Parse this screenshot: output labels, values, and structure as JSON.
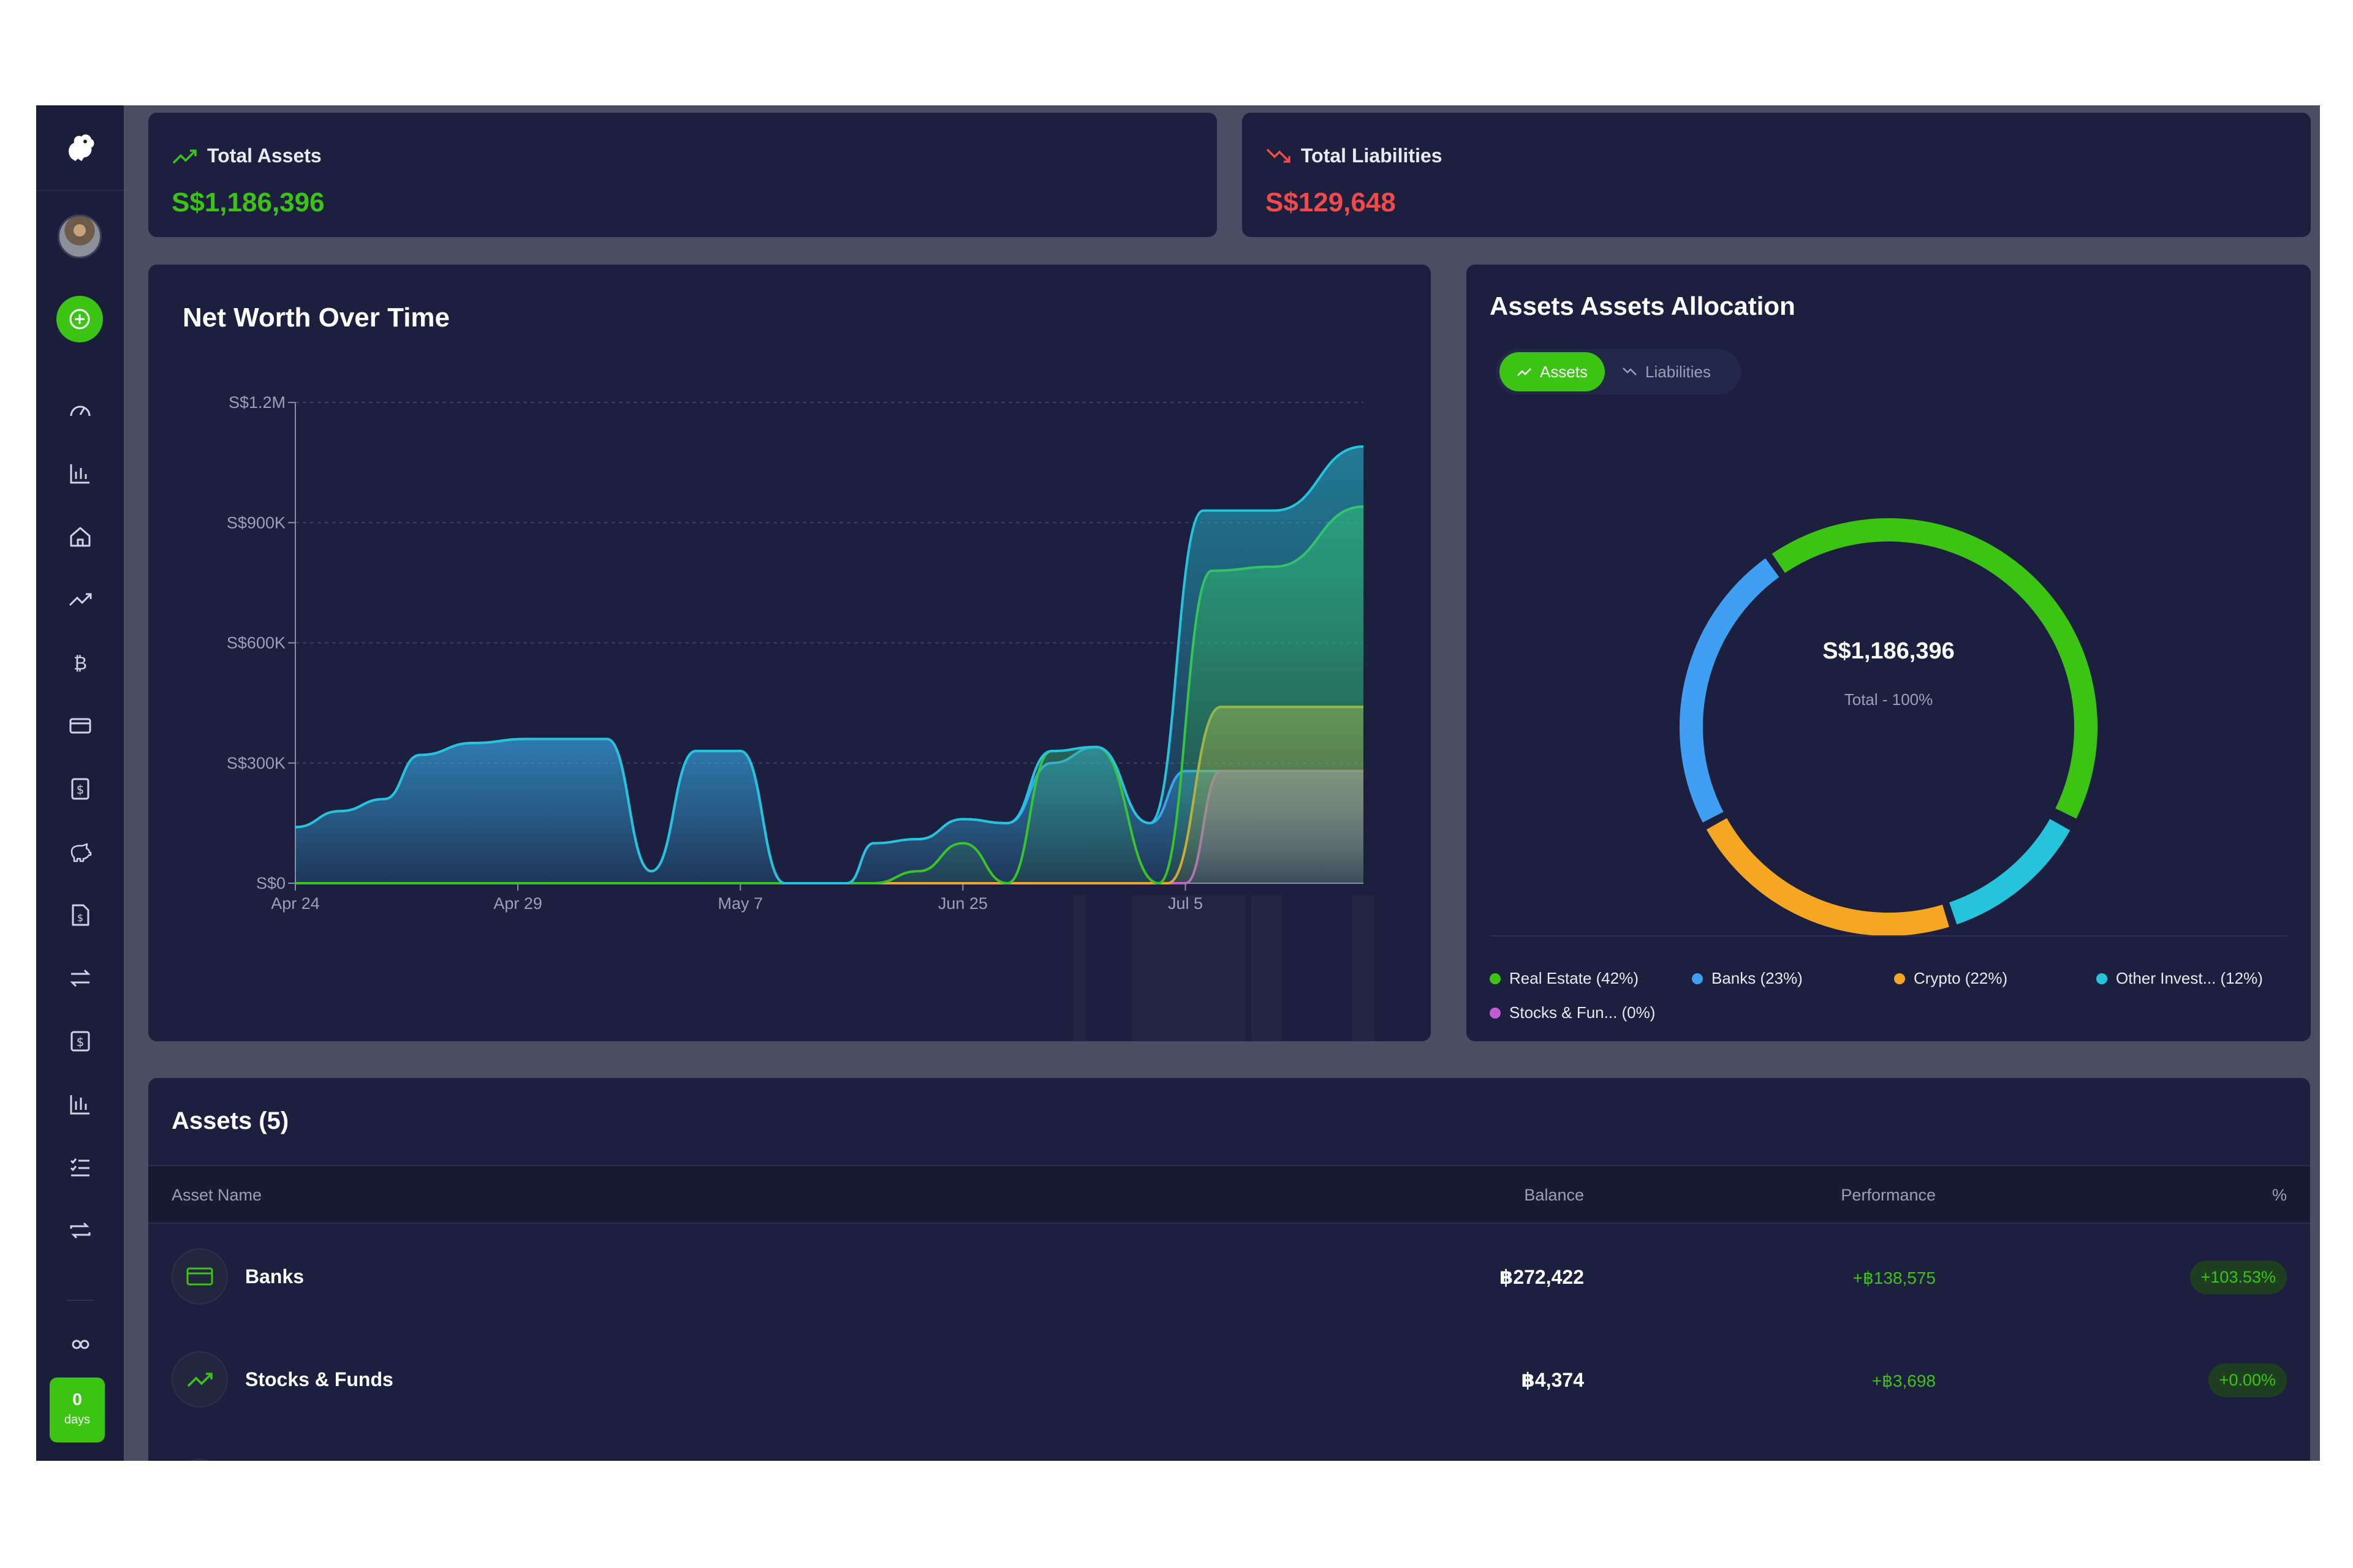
{
  "sidebar": {
    "nav": [
      "gauge-icon",
      "bar-chart-icon",
      "home-icon",
      "trending-up-icon",
      "bitcoin-icon",
      "credit-card-icon",
      "dollar-doc-icon",
      "piggy-bank-icon",
      "file-dollar-icon",
      "swap-arrows-icon",
      "dollar-box-icon",
      "bar-chart-2-icon",
      "list-check-icon",
      "repeat-icon"
    ],
    "streak_value": "0",
    "streak_label": "days"
  },
  "summary": {
    "assets_title": "Total Assets",
    "assets_value": "S$1,186,396",
    "liabilities_title": "Total Liabilities",
    "liabilities_value": "S$129,648"
  },
  "colors": {
    "green": "#3bc414",
    "red": "#f24a4a",
    "blue": "#3f9ff2",
    "orange": "#f5a623",
    "cyan": "#25c4dc",
    "purple": "#c25bd1",
    "card": "#1c1f3d"
  },
  "networth": {
    "title": "Net Worth Over Time",
    "chart_data": {
      "type": "area",
      "title": "Net Worth Over Time",
      "xlabel": "",
      "ylabel": "",
      "ylim": [
        0,
        1200000
      ],
      "yticks": [
        "S$0",
        "S$300K",
        "S$600K",
        "S$900K",
        "S$1.2M"
      ],
      "xticks": [
        "Apr 24",
        "Apr 29",
        "May 7",
        "Jun 25",
        "Jul 5"
      ],
      "series": [
        {
          "name": "Banks",
          "color": "#3f9ff2",
          "values": [
            [
              0,
              140000
            ],
            [
              1.0,
              180000
            ],
            [
              2.0,
              210000
            ],
            [
              2.8,
              320000
            ],
            [
              4.0,
              350000
            ],
            [
              5.2,
              360000
            ],
            [
              6.0,
              360000
            ],
            [
              7.0,
              360000
            ],
            [
              8.0,
              30000
            ],
            [
              9.0,
              330000
            ],
            [
              10.0,
              330000
            ],
            [
              11.0,
              0
            ],
            [
              12.4,
              0
            ],
            [
              13.0,
              100000
            ],
            [
              14.0,
              110000
            ],
            [
              15.0,
              160000
            ],
            [
              16.0,
              150000
            ],
            [
              17.0,
              300000
            ],
            [
              18.0,
              340000
            ],
            [
              19.2,
              150000
            ],
            [
              20.0,
              280000
            ],
            [
              24.0,
              280000
            ]
          ]
        },
        {
          "name": "Stocks & Fun...",
          "color": "#c25bd1",
          "values": [
            [
              0,
              0
            ],
            [
              13,
              0
            ],
            [
              16,
              0
            ],
            [
              20,
              0
            ],
            [
              20.8,
              280000
            ],
            [
              24,
              280000
            ]
          ]
        },
        {
          "name": "Crypto",
          "color": "#f5a623",
          "values": [
            [
              0,
              0
            ],
            [
              13,
              0
            ],
            [
              14,
              0
            ],
            [
              15,
              0
            ],
            [
              18,
              0
            ],
            [
              19.6,
              0
            ],
            [
              20.8,
              440000
            ],
            [
              24,
              440000
            ]
          ]
        },
        {
          "name": "Real Estate",
          "color": "#3bc414",
          "values": [
            [
              0,
              0
            ],
            [
              13,
              0
            ],
            [
              14,
              30000
            ],
            [
              15,
              100000
            ],
            [
              16,
              0
            ],
            [
              17,
              330000
            ],
            [
              18,
              340000
            ],
            [
              19.4,
              0
            ],
            [
              20.6,
              780000
            ],
            [
              22,
              790000
            ],
            [
              24,
              940000
            ]
          ]
        },
        {
          "name": "Other Invest...",
          "color": "#25c4dc",
          "values": [
            [
              0,
              140000
            ],
            [
              1.0,
              180000
            ],
            [
              2.0,
              210000
            ],
            [
              2.8,
              320000
            ],
            [
              4.0,
              350000
            ],
            [
              5.2,
              360000
            ],
            [
              6.0,
              360000
            ],
            [
              7.0,
              360000
            ],
            [
              8.0,
              30000
            ],
            [
              9.0,
              330000
            ],
            [
              10.0,
              330000
            ],
            [
              11.0,
              0
            ],
            [
              12.4,
              0
            ],
            [
              13.0,
              100000
            ],
            [
              14.0,
              110000
            ],
            [
              15.0,
              160000
            ],
            [
              16.0,
              150000
            ],
            [
              17.0,
              330000
            ],
            [
              18.0,
              340000
            ],
            [
              19.2,
              150000
            ],
            [
              20.4,
              930000
            ],
            [
              22,
              930000
            ],
            [
              24,
              1090000
            ]
          ]
        }
      ]
    }
  },
  "allocation": {
    "title": "Assets Assets Allocation",
    "tab_assets": "Assets",
    "tab_liabilities": "Liabilities",
    "center_value": "S$1,186,396",
    "center_label": "Total - 100%",
    "chart_data": {
      "type": "pie",
      "donut": true,
      "slices": [
        {
          "label": "Real Estate (42%)",
          "value": 42,
          "color": "#3bc414"
        },
        {
          "label": "Stocks & Fun... (0%)",
          "value": 0.4,
          "color": "#c25bd1"
        },
        {
          "label": "Other Invest... (12%)",
          "value": 12,
          "color": "#25c4dc"
        },
        {
          "label": "Crypto (22%)",
          "value": 22,
          "color": "#f5a623"
        },
        {
          "label": "Banks (23%)",
          "value": 23,
          "color": "#3f9ff2"
        }
      ]
    },
    "legend": [
      {
        "label": "Real Estate (42%)",
        "color": "#3bc414"
      },
      {
        "label": "Banks (23%)",
        "color": "#3f9ff2"
      },
      {
        "label": "Crypto (22%)",
        "color": "#f5a623"
      },
      {
        "label": "Other Invest... (12%)",
        "color": "#25c4dc"
      },
      {
        "label": "Stocks & Fun... (0%)",
        "color": "#c25bd1"
      }
    ]
  },
  "assets_table": {
    "title": "Assets (5)",
    "columns": {
      "name": "Asset Name",
      "balance": "Balance",
      "performance": "Performance",
      "pct": "%"
    },
    "rows": [
      {
        "icon": "credit-card-icon",
        "name": "Banks",
        "balance": "฿272,422",
        "performance": "+฿138,575",
        "pct": "+103.53%"
      },
      {
        "icon": "trending-up-icon",
        "name": "Stocks & Funds",
        "balance": "฿4,374",
        "performance": "+฿3,698",
        "pct": "+0.00%"
      }
    ]
  }
}
